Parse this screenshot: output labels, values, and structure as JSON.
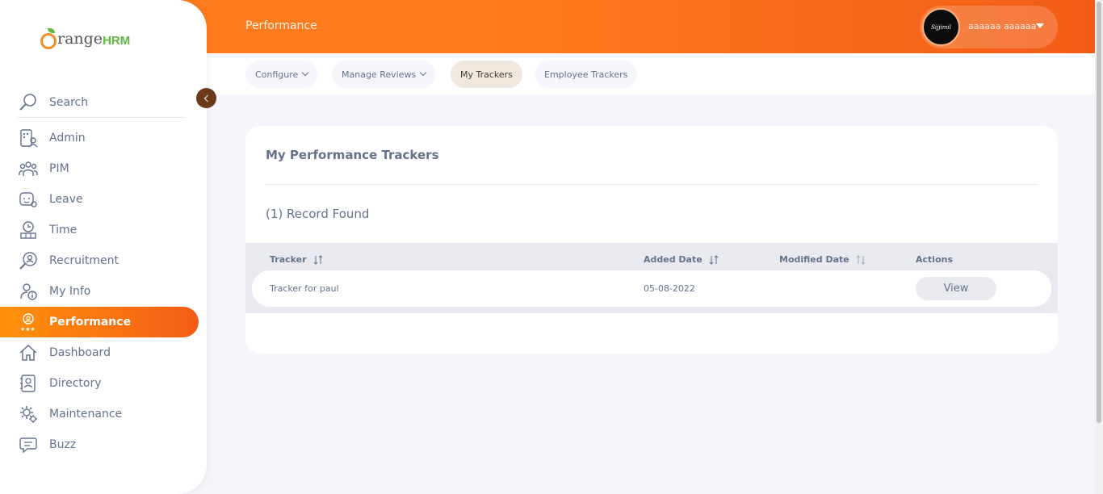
{
  "app": {
    "logo_text": "range",
    "logo_suffix": "HRM"
  },
  "header": {
    "title": "Performance",
    "user_name": "aaaaaa aaaaaa",
    "avatar_text": "Sijjimil"
  },
  "subnav": {
    "items": [
      {
        "label": "Configure",
        "dropdown": true
      },
      {
        "label": "Manage Reviews",
        "dropdown": true
      },
      {
        "label": "My Trackers",
        "dropdown": false,
        "active": true
      },
      {
        "label": "Employee Trackers",
        "dropdown": false
      }
    ]
  },
  "sidebar": {
    "search_label": "Search",
    "items": [
      {
        "label": "Admin",
        "icon": "admin-icon"
      },
      {
        "label": "PIM",
        "icon": "pim-icon"
      },
      {
        "label": "Leave",
        "icon": "leave-icon"
      },
      {
        "label": "Time",
        "icon": "time-icon"
      },
      {
        "label": "Recruitment",
        "icon": "recruitment-icon"
      },
      {
        "label": "My Info",
        "icon": "my-info-icon"
      },
      {
        "label": "Performance",
        "icon": "performance-icon",
        "active": true
      },
      {
        "label": "Dashboard",
        "icon": "dashboard-icon"
      },
      {
        "label": "Directory",
        "icon": "directory-icon"
      },
      {
        "label": "Maintenance",
        "icon": "maintenance-icon"
      },
      {
        "label": "Buzz",
        "icon": "buzz-icon"
      }
    ]
  },
  "main": {
    "title": "My Performance Trackers",
    "records_found": "(1) Record Found",
    "table": {
      "columns": [
        "Tracker",
        "Added Date",
        "Modified Date",
        "Actions"
      ],
      "rows": [
        {
          "tracker": "Tracker for paul",
          "added_date": "05-08-2022",
          "modified_date": "",
          "action": "View"
        }
      ]
    }
  },
  "colors": {
    "brand_orange": "#ff7b1d",
    "brand_orange_dark": "#f35c17",
    "text": "#64728c",
    "logo_green": "#5cb83f"
  }
}
